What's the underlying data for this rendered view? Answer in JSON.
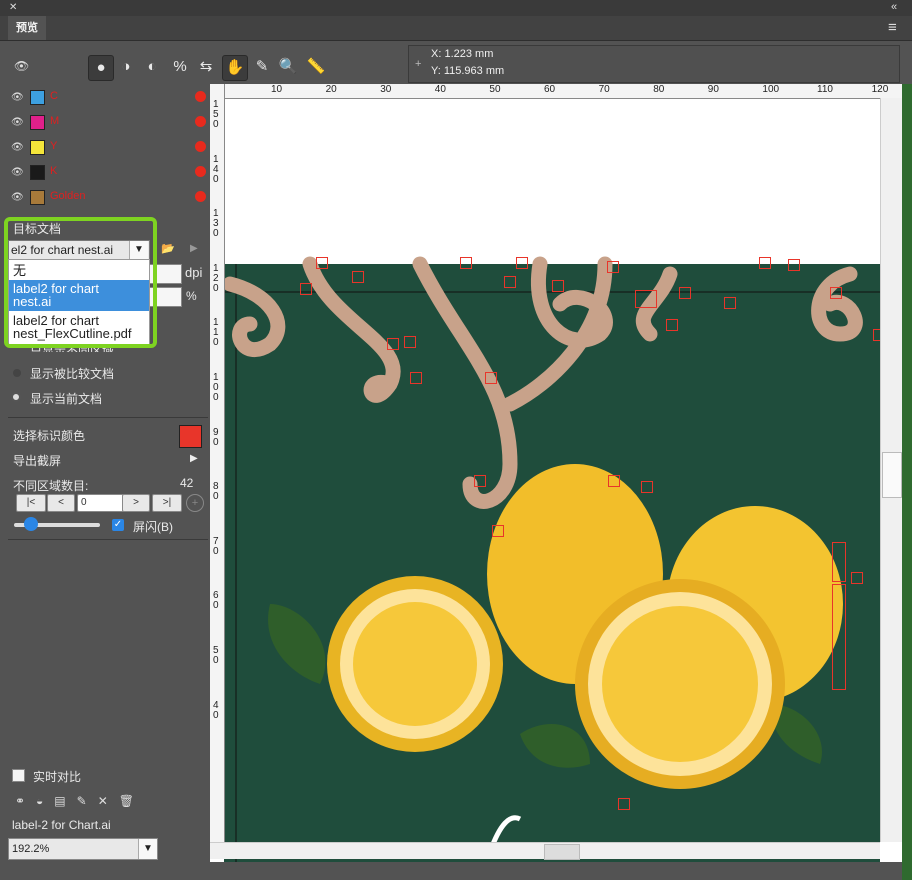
{
  "window": {
    "close_glyph": "✕",
    "collapse_glyph": "«",
    "tab_label": "预览",
    "menu_glyph": "≡"
  },
  "toolbar": {
    "eye_glyph": "👁",
    "tools": [
      {
        "name": "view-separation-icon",
        "glyph": "●"
      },
      {
        "name": "view-half-icon",
        "glyph": "◑"
      },
      {
        "name": "view-right-icon",
        "glyph": "◐"
      },
      {
        "name": "percent-icon",
        "glyph": "%"
      },
      {
        "name": "flip-icon",
        "glyph": "⇆"
      },
      {
        "name": "hand-icon",
        "glyph": "✋"
      },
      {
        "name": "eyedropper-icon",
        "glyph": "✎"
      },
      {
        "name": "zoom-icon",
        "glyph": "🔍"
      },
      {
        "name": "ruler-icon",
        "glyph": "📏"
      }
    ],
    "coords": {
      "plus": "+",
      "x": "X: 1.223 mm",
      "y": "Y: 115.963 mm"
    }
  },
  "separations": [
    {
      "name": "C",
      "color": "#3da0e0"
    },
    {
      "name": "M",
      "color": "#e0208a"
    },
    {
      "name": "Y",
      "color": "#f5e53a"
    },
    {
      "name": "K",
      "color": "#1a1a1a"
    },
    {
      "name": "Golden",
      "color": "#a87a3a"
    }
  ],
  "target": {
    "section_label": "目标文档",
    "selected": "el2 for chart nest.ai",
    "dropdown_items": [
      {
        "label": "无"
      },
      {
        "label": "label2 for chart nest.ai"
      },
      {
        "label": "label2 for chart nest_FlexCutline.pdf"
      }
    ],
    "dpi_label": "dpi",
    "percent_label": "%"
  },
  "display": {
    "option_partial": "只显示不同区域",
    "option_compare": "显示被比较文档",
    "option_current": "显示当前文档"
  },
  "select_color_label": "选择标识颜色",
  "select_color": "#e8352a",
  "export_label": "导出截屏",
  "diff_count_label": "不同区域数目:",
  "diff_count": "42",
  "nav": {
    "first": "|<",
    "prev": "<",
    "value": "0",
    "next": ">",
    "last": ">|"
  },
  "flash_label": "屏闪(B)",
  "realtime_label": "实时对比",
  "filename": "label-2 for Chart.ai",
  "zoom": "192.2%",
  "ruler_top": [
    "10",
    "20",
    "30",
    "40",
    "50",
    "60",
    "70",
    "80",
    "90",
    "100",
    "110",
    "120"
  ],
  "ruler_left": [
    "1 5 0",
    "1 4 0",
    "1 3 0",
    "1 2 0",
    "1 1 0",
    "1 0 0",
    "9 0",
    "8 0",
    "7 0",
    "6 0",
    "5 0",
    "4 0"
  ]
}
